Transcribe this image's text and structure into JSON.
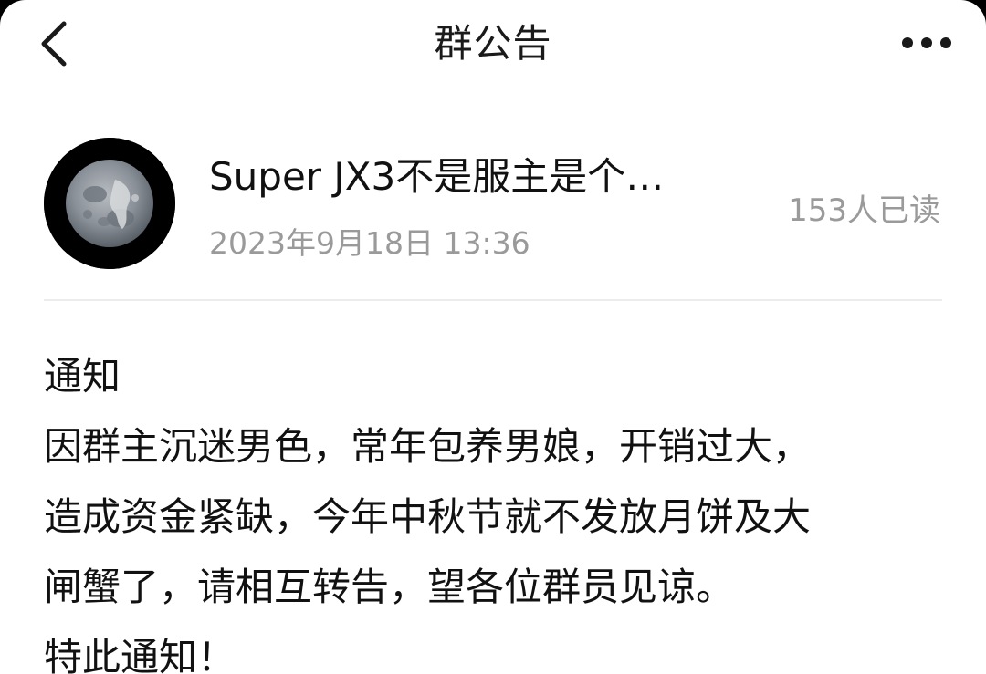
{
  "header": {
    "title": "群公告",
    "back_icon": "chevron-left-icon",
    "more_icon": "more-horizontal-icon"
  },
  "announcement": {
    "author_name": "Super JX3不是服主是个…",
    "timestamp": "2023年9月18日 13:36",
    "read_count": "153人已读",
    "avatar_icon": "moon-avatar",
    "body_lines": [
      "通知",
      "因群主沉迷男色，常年包养男娘，开销过大，",
      "造成资金紧缺，今年中秋节就不发放月饼及大",
      "闸蟹了，请相互转告，望各位群员见谅。",
      "特此通知！"
    ]
  }
}
